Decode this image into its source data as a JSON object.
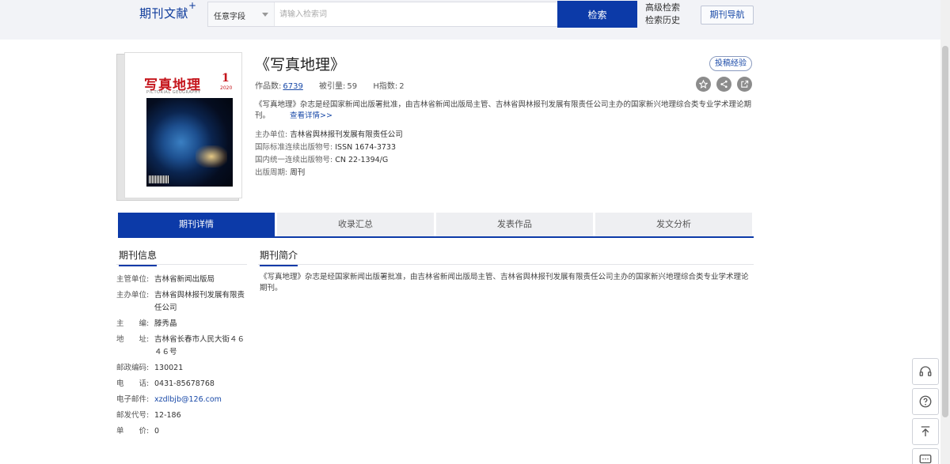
{
  "header": {
    "logo": "期刊文献",
    "logo_plus": "+",
    "search_field": "任意字段",
    "search_placeholder": "请输入检索词",
    "search_button": "检索",
    "advanced_search": "高级检索",
    "search_history": "检索历史",
    "journal_nav": "期刊导航"
  },
  "cover": {
    "title": "写真地理",
    "issue": "1",
    "year": "2020",
    "subtitle": "PICTORIAL GEOGRAPHY"
  },
  "journal": {
    "title": "《写真地理》",
    "works_label": "作品数:",
    "works_value": "6739",
    "cited_label": "被引量:",
    "cited_value": "59",
    "h_label": "H指数:",
    "h_value": "2",
    "tougao_button": "投稿经验",
    "description": "《写真地理》杂志是经国家新闻出版署批准，由吉林省新闻出版局主管、吉林省舆林报刊发展有限责任公司主办的国家新兴地理综合类专业学术理论期刊。",
    "more_link": "查看详情>>",
    "sponsor_label": "主办单位:",
    "sponsor_value": "吉林省舆林报刊发展有限责任公司",
    "issn_label": "国际标准连续出版物号:",
    "issn_value": "ISSN 1674-3733",
    "cn_label": "国内统一连续出版物号:",
    "cn_value": "CN 22-1394/G",
    "cycle_label": "出版周期:",
    "cycle_value": "周刊"
  },
  "tabs": [
    "期刊详情",
    "收录汇总",
    "发表作品",
    "发文分析"
  ],
  "info_panel": {
    "title": "期刊信息",
    "rows": [
      {
        "label": "主管单位:",
        "value": "吉林省新闻出版局"
      },
      {
        "label": "主办单位:",
        "value": "吉林省舆林报刊发展有限责任公司"
      },
      {
        "label": "主　　编:",
        "value": "滕秀晶"
      },
      {
        "label": "地　　址:",
        "value": "吉林省长春市人民大街４６４６号"
      },
      {
        "label": "邮政编码:",
        "value": "130021"
      },
      {
        "label": "电　　话:",
        "value": "0431-85678768"
      },
      {
        "label": "电子邮件:",
        "value": "xzdlbjb@126.com"
      },
      {
        "label": "邮发代号:",
        "value": "12-186"
      },
      {
        "label": "单　　价:",
        "value": "0"
      }
    ]
  },
  "intro_panel": {
    "title": "期刊简介",
    "text": "《写真地理》杂志是经国家新闻出版署批准，由吉林省新闻出版局主管、吉林省舆林报刊发展有限责任公司主办的国家新兴地理综合类专业学术理论期刊。"
  },
  "icons": {
    "favorite": "star-icon",
    "share": "share-icon",
    "external": "external-link-icon",
    "support": "headset-icon",
    "help": "question-icon",
    "top": "back-to-top-icon",
    "chat": "chat-icon"
  }
}
